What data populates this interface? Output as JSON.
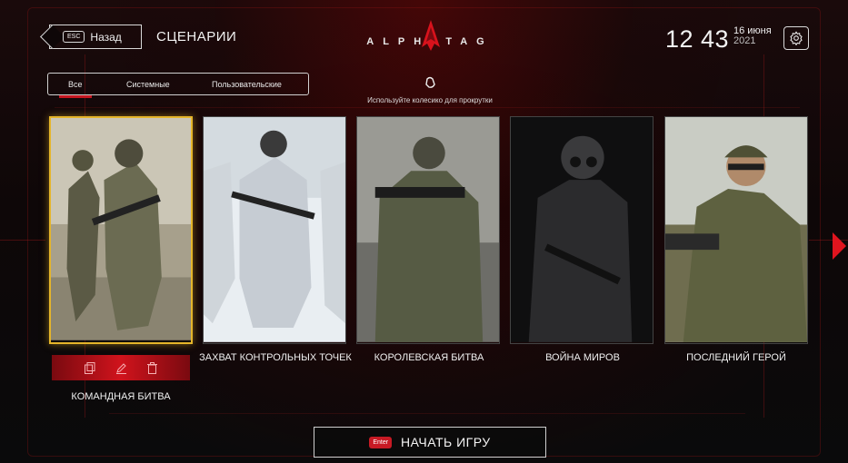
{
  "header": {
    "back_key": "ESC",
    "back_label": "Назад",
    "title": "СЦЕНАРИИ",
    "logo": "ALPHATAG",
    "time": "12 43",
    "date_day": "16 июня",
    "date_year": "2021"
  },
  "tabs": [
    {
      "label": "Все",
      "active": true
    },
    {
      "label": "Системные",
      "active": false
    },
    {
      "label": "Пользовательские",
      "active": false
    }
  ],
  "hint": {
    "icon": "mouse-icon",
    "text": "Используйте колесико для прокрутки"
  },
  "scenarios": [
    {
      "label": "КОМАНДНАЯ БИТВА",
      "selected": true
    },
    {
      "label": "ЗАХВАТ КОНТРОЛЬНЫХ ТОЧЕК",
      "selected": false
    },
    {
      "label": "КОРОЛЕВСКАЯ БИТВА",
      "selected": false
    },
    {
      "label": "ВОЙНА МИРОВ",
      "selected": false
    },
    {
      "label": "ПОСЛЕДНИЙ ГЕРОЙ",
      "selected": false
    }
  ],
  "actions": [
    "copy-icon",
    "edit-icon",
    "delete-icon"
  ],
  "start": {
    "key": "Enter",
    "label": "НАЧАТЬ ИГРУ"
  },
  "colors": {
    "accent": "#c41620",
    "selection": "#e5b52a"
  }
}
